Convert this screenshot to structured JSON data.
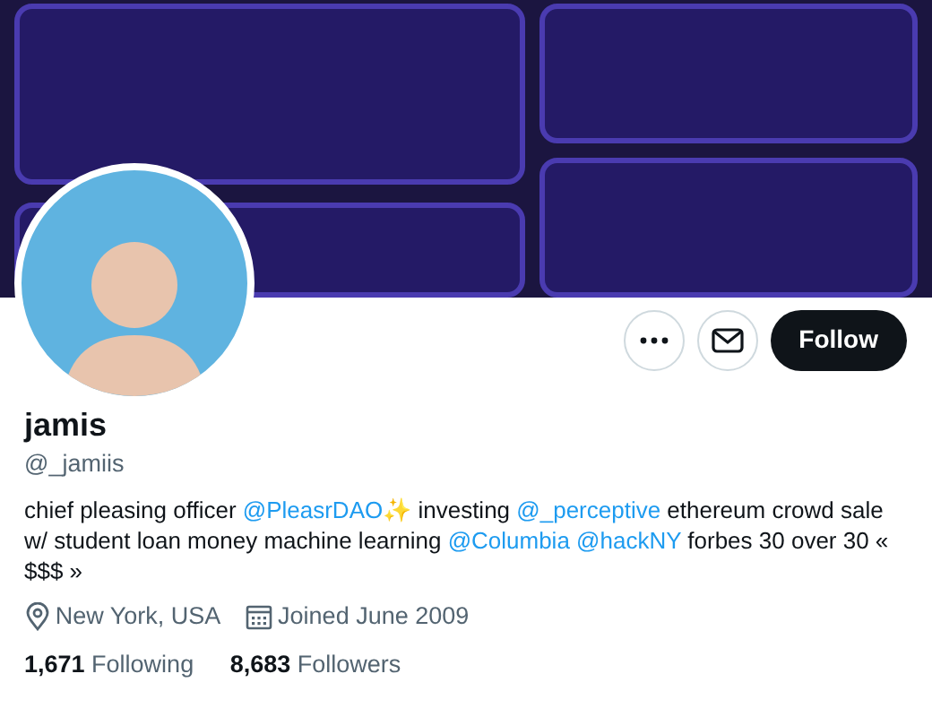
{
  "profile": {
    "name": "jamis",
    "handle": "@_jamiis",
    "bio": [
      {
        "kind": "text",
        "text": "chief pleasing officer "
      },
      {
        "kind": "mention",
        "text": "@PleasrDAO"
      },
      {
        "kind": "emoji",
        "text": "✨"
      },
      {
        "kind": "text",
        "text": " investing "
      },
      {
        "kind": "mention",
        "text": "@_perceptive"
      },
      {
        "kind": "text",
        "text": " ethereum crowd sale w/ student loan money machine learning "
      },
      {
        "kind": "mention",
        "text": "@Columbia "
      },
      {
        "kind": "mention",
        "text": "@hackNY"
      },
      {
        "kind": "text",
        "text": " forbes 30 over 30 « $$$ »"
      }
    ],
    "location": "New York, USA",
    "joined": "Joined June 2009",
    "stats": [
      {
        "count": "1,671",
        "label": "Following"
      },
      {
        "count": "8,683",
        "label": "Followers"
      }
    ]
  },
  "actions": {
    "follow": "Follow"
  }
}
